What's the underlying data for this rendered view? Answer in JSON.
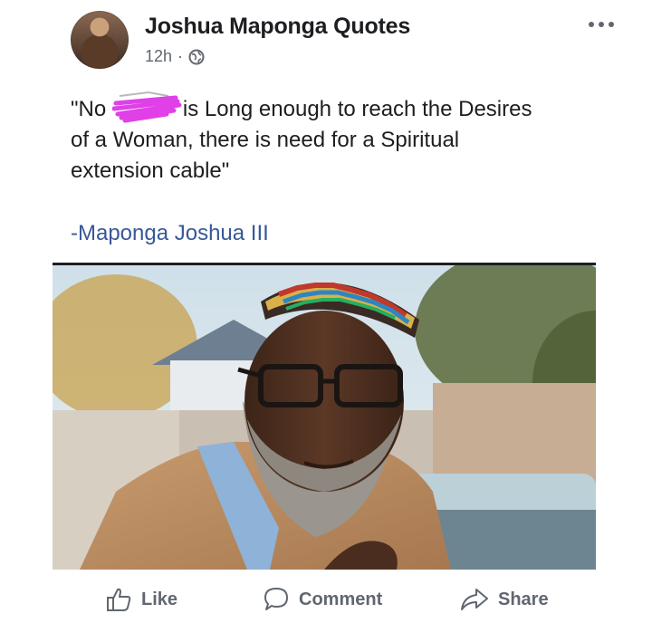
{
  "post": {
    "author": "Joshua Maponga Quotes",
    "time": "12h",
    "separator": "·",
    "quote_open": "\"No ",
    "quote_rest_line1": "is Long enough to reach the Desires",
    "quote_line2": "of a Woman, there is need for a Spiritual",
    "quote_line3": "extension cable\"",
    "attribution": "-Maponga Joshua III"
  },
  "actions": {
    "like_label": "Like",
    "comment_label": "Comment",
    "share_label": "Share"
  },
  "colors": {
    "text": "#1c1e21",
    "secondary": "#606770",
    "link": "#385898",
    "censor_mark": "#e040e8"
  },
  "icons": {
    "globe": "globe-icon",
    "more": "more-options-icon",
    "like": "thumbs-up-icon",
    "comment": "comment-bubble-icon",
    "share": "share-arrow-icon"
  }
}
